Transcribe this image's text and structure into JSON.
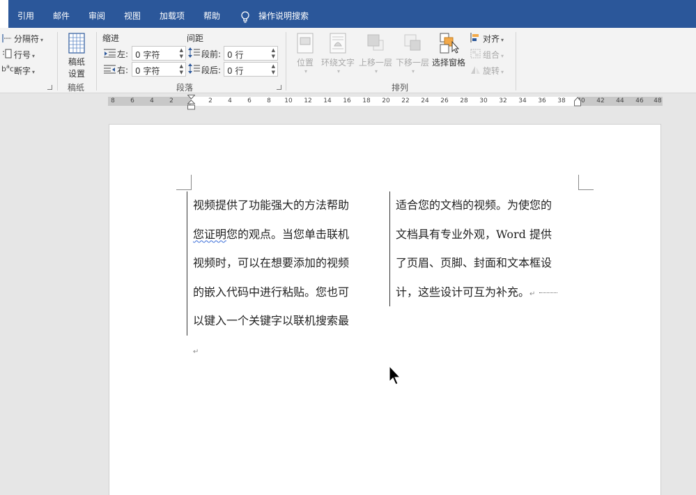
{
  "tabs": [
    {
      "label": "引用"
    },
    {
      "label": "邮件"
    },
    {
      "label": "审阅"
    },
    {
      "label": "视图"
    },
    {
      "label": "加载项"
    },
    {
      "label": "帮助"
    }
  ],
  "tell_me": {
    "label": "操作说明搜索"
  },
  "ribbon": {
    "page_setup": {
      "breaks": "分隔符",
      "line_numbers": "行号",
      "hyphenation": "断字"
    },
    "manuscript": {
      "setup_line1": "稿纸",
      "setup_line2": "设置",
      "group_label": "稿纸"
    },
    "paragraph": {
      "indent_header": "缩进",
      "spacing_header": "间距",
      "left_label": "左:",
      "right_label": "右:",
      "before_label": "段前:",
      "after_label": "段后:",
      "left_value": "0 字符",
      "right_value": "0 字符",
      "before_value": "0 行",
      "after_value": "0 行",
      "group_label": "段落"
    },
    "arrange": {
      "position": "位置",
      "wrap_text": "环绕文字",
      "bring_forward": "上移一层",
      "send_backward": "下移一层",
      "selection_pane": "选择窗格",
      "align": "对齐",
      "group": "组合",
      "rotate": "旋转",
      "group_label": "排列"
    }
  },
  "ruler": {
    "left_ticks": [
      "8",
      "6",
      "4",
      "2"
    ],
    "right_ticks": [
      "2",
      "4",
      "6",
      "8",
      "10",
      "12",
      "14",
      "16",
      "18",
      "20",
      "22",
      "24",
      "26",
      "28",
      "30",
      "32",
      "34",
      "36",
      "38"
    ],
    "tail_ticks": [
      "40",
      "42",
      "44",
      "46",
      "48"
    ]
  },
  "document": {
    "col1": {
      "line1": "视频提供了功能强大的方法帮助",
      "line2_err": "您证明",
      "line2_rest": "您的观点。当您单击联机",
      "line3": "视频时，可以在想要添加的视频",
      "line4": "的嵌入代码中进行粘贴。您也可",
      "line5": "以键入一个关键字以联机搜索最"
    },
    "col2": {
      "line1": "适合您的文档的视频。为使您的",
      "line2": "文档具有专业外观，Word 提供",
      "line3": "了页眉、页脚、封面和文本框设",
      "line4": "计，这些设计可互为补充。"
    },
    "paragraph_mark": "↵"
  }
}
